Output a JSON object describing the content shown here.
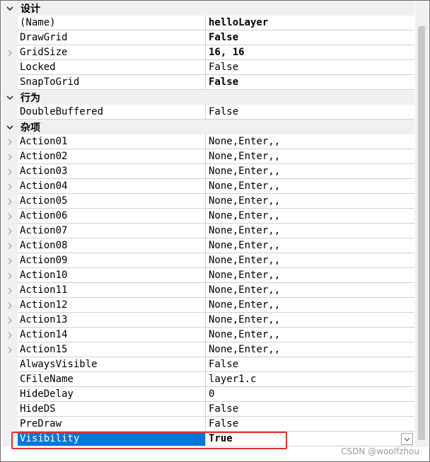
{
  "categories": [
    {
      "label": "设计",
      "rows": [
        {
          "name": "(Name)",
          "value": "helloLayer",
          "bold": true,
          "expandable": false
        },
        {
          "name": "DrawGrid",
          "value": "False",
          "bold": true,
          "expandable": false
        },
        {
          "name": "GridSize",
          "value": "16, 16",
          "bold": true,
          "expandable": true
        },
        {
          "name": "Locked",
          "value": "False",
          "bold": false,
          "expandable": false
        },
        {
          "name": "SnapToGrid",
          "value": "False",
          "bold": true,
          "expandable": false
        }
      ]
    },
    {
      "label": "行为",
      "rows": [
        {
          "name": "DoubleBuffered",
          "value": "False",
          "bold": false,
          "expandable": false
        }
      ]
    },
    {
      "label": "杂项",
      "rows": [
        {
          "name": "Action01",
          "value": "None,Enter,,",
          "bold": false,
          "expandable": true
        },
        {
          "name": "Action02",
          "value": "None,Enter,,",
          "bold": false,
          "expandable": true
        },
        {
          "name": "Action03",
          "value": "None,Enter,,",
          "bold": false,
          "expandable": true
        },
        {
          "name": "Action04",
          "value": "None,Enter,,",
          "bold": false,
          "expandable": true
        },
        {
          "name": "Action05",
          "value": "None,Enter,,",
          "bold": false,
          "expandable": true
        },
        {
          "name": "Action06",
          "value": "None,Enter,,",
          "bold": false,
          "expandable": true
        },
        {
          "name": "Action07",
          "value": "None,Enter,,",
          "bold": false,
          "expandable": true
        },
        {
          "name": "Action08",
          "value": "None,Enter,,",
          "bold": false,
          "expandable": true
        },
        {
          "name": "Action09",
          "value": "None,Enter,,",
          "bold": false,
          "expandable": true
        },
        {
          "name": "Action10",
          "value": "None,Enter,,",
          "bold": false,
          "expandable": true
        },
        {
          "name": "Action11",
          "value": "None,Enter,,",
          "bold": false,
          "expandable": true
        },
        {
          "name": "Action12",
          "value": "None,Enter,,",
          "bold": false,
          "expandable": true
        },
        {
          "name": "Action13",
          "value": "None,Enter,,",
          "bold": false,
          "expandable": true
        },
        {
          "name": "Action14",
          "value": "None,Enter,,",
          "bold": false,
          "expandable": true
        },
        {
          "name": "Action15",
          "value": "None,Enter,,",
          "bold": false,
          "expandable": true
        },
        {
          "name": "AlwaysVisible",
          "value": "False",
          "bold": false,
          "expandable": false
        },
        {
          "name": "CFileName",
          "value": "layer1.c",
          "bold": false,
          "expandable": false
        },
        {
          "name": "HideDelay",
          "value": "0",
          "bold": false,
          "expandable": false
        },
        {
          "name": "HideDS",
          "value": "False",
          "bold": false,
          "expandable": false
        },
        {
          "name": "PreDraw",
          "value": "False",
          "bold": false,
          "expandable": false
        },
        {
          "name": "Visibility",
          "value": "True",
          "bold": true,
          "expandable": false,
          "selected": true
        }
      ]
    }
  ],
  "watermark": "CSDN @woolfzhou",
  "colors": {
    "selection": "#0078d7",
    "highlight_box": "#e03030",
    "category_bg": "#f0f0f0"
  }
}
